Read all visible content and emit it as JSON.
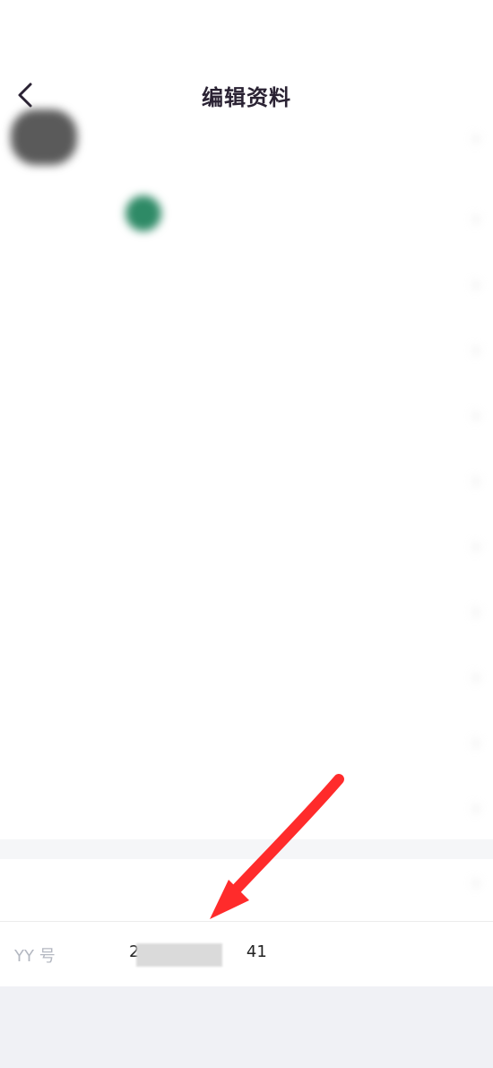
{
  "header": {
    "title": "编辑资料"
  },
  "profile": {
    "yy_label": "YY 号",
    "yy_value_prefix": "2",
    "yy_value_suffix": "41"
  },
  "icons": {
    "back": "chevron-left-icon"
  },
  "colors": {
    "title": "#2a2233",
    "background": "#ffffff",
    "bottom_bar": "#f0f1f5",
    "annotation_arrow": "#ff2b2b"
  }
}
